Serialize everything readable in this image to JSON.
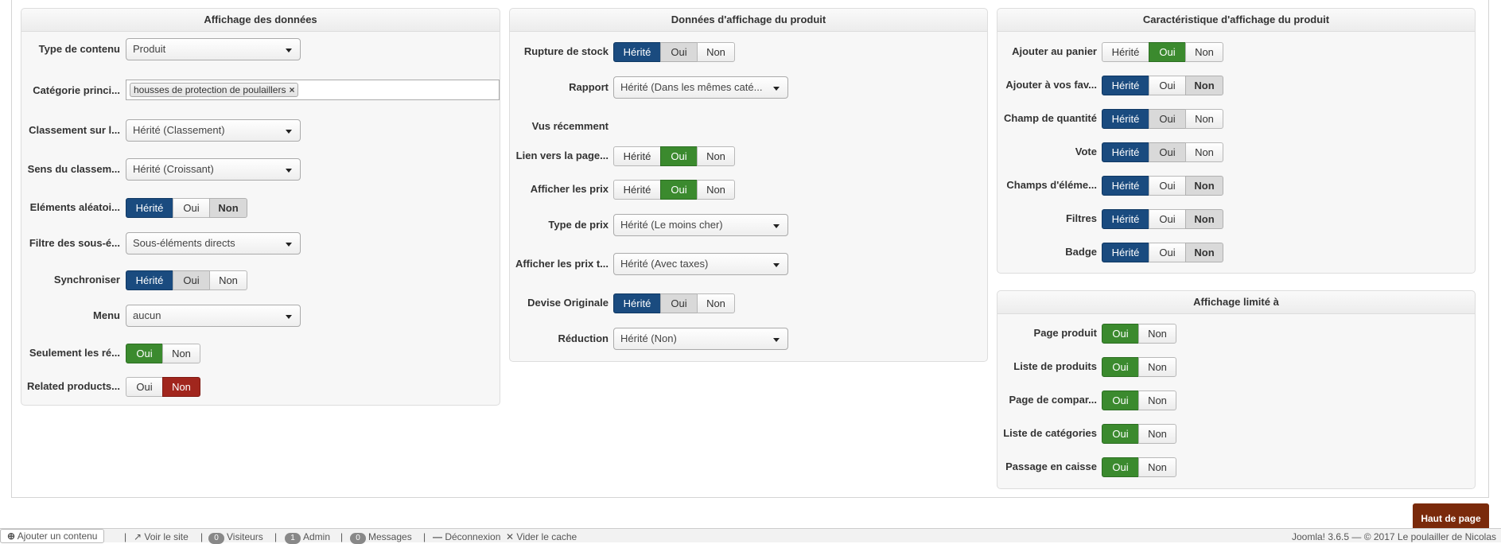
{
  "panel1": {
    "title": "Affichage des données",
    "type_contenu": {
      "label": "Type de contenu",
      "value": "Produit"
    },
    "categorie": {
      "label": "Catégorie princi...",
      "tag": "housses de protection de poulaillers"
    },
    "classement": {
      "label": "Classement sur l...",
      "value": "Hérité (Classement)"
    },
    "sens": {
      "label": "Sens du classem...",
      "value": "Hérité (Croissant)"
    },
    "aleatoire": {
      "label": "Eléments aléatoi...",
      "opt1": "Hérité",
      "opt2": "Oui",
      "opt3": "Non"
    },
    "filtre": {
      "label": "Filtre des sous-é...",
      "value": "Sous-éléments directs"
    },
    "synchroniser": {
      "label": "Synchroniser",
      "opt1": "Hérité",
      "opt2": "Oui",
      "opt3": "Non"
    },
    "menu": {
      "label": "Menu",
      "value": "aucun"
    },
    "seulement": {
      "label": "Seulement les ré...",
      "opt1": "Oui",
      "opt2": "Non"
    },
    "related": {
      "label": "Related products...",
      "opt1": "Oui",
      "opt2": "Non"
    }
  },
  "panel2": {
    "title": "Données d'affichage du produit",
    "rupture": {
      "label": "Rupture de stock",
      "opt1": "Hérité",
      "opt2": "Oui",
      "opt3": "Non"
    },
    "rapport": {
      "label": "Rapport",
      "value": "Hérité (Dans les mêmes caté..."
    },
    "vus": {
      "label": "Vus récemment"
    },
    "lien": {
      "label": "Lien vers la page...",
      "opt1": "Hérité",
      "opt2": "Oui",
      "opt3": "Non"
    },
    "afficher_prix": {
      "label": "Afficher les prix",
      "opt1": "Hérité",
      "opt2": "Oui",
      "opt3": "Non"
    },
    "type_prix": {
      "label": "Type de prix",
      "value": "Hérité (Le moins cher)"
    },
    "prix_taxes": {
      "label": "Afficher les prix t...",
      "value": "Hérité (Avec taxes)"
    },
    "devise": {
      "label": "Devise Originale",
      "opt1": "Hérité",
      "opt2": "Oui",
      "opt3": "Non"
    },
    "reduction": {
      "label": "Réduction",
      "value": "Hérité (Non)"
    }
  },
  "panel3": {
    "title": "Caractéristique d'affichage du produit",
    "panier": {
      "label": "Ajouter au panier",
      "opt1": "Hérité",
      "opt2": "Oui",
      "opt3": "Non"
    },
    "favoris": {
      "label": "Ajouter à vos fav...",
      "opt1": "Hérité",
      "opt2": "Oui",
      "opt3": "Non"
    },
    "quantite": {
      "label": "Champ de quantité",
      "opt1": "Hérité",
      "opt2": "Oui",
      "opt3": "Non"
    },
    "vote": {
      "label": "Vote",
      "opt1": "Hérité",
      "opt2": "Oui",
      "opt3": "Non"
    },
    "champs": {
      "label": "Champs d'éléme...",
      "opt1": "Hérité",
      "opt2": "Oui",
      "opt3": "Non"
    },
    "filtres": {
      "label": "Filtres",
      "opt1": "Hérité",
      "opt2": "Oui",
      "opt3": "Non"
    },
    "badge": {
      "label": "Badge",
      "opt1": "Hérité",
      "opt2": "Oui",
      "opt3": "Non"
    }
  },
  "panel4": {
    "title": "Affichage limité à",
    "page_produit": {
      "label": "Page produit",
      "opt1": "Oui",
      "opt2": "Non"
    },
    "liste_produits": {
      "label": "Liste de produits",
      "opt1": "Oui",
      "opt2": "Non"
    },
    "page_compar": {
      "label": "Page de compar...",
      "opt1": "Oui",
      "opt2": "Non"
    },
    "liste_categories": {
      "label": "Liste de catégories",
      "opt1": "Oui",
      "opt2": "Non"
    },
    "passage": {
      "label": "Passage en caisse",
      "opt1": "Oui",
      "opt2": "Non"
    }
  },
  "top_button": "Haut de page",
  "footer": {
    "add_content": "Ajouter un contenu",
    "voir_site": "Voir le site",
    "visiteurs_count": "0",
    "visiteurs": "Visiteurs",
    "admin_count": "1",
    "admin": "Admin",
    "messages_count": "0",
    "messages": "Messages",
    "deconnexion": "Déconnexion",
    "vider_cache": "Vider le cache",
    "copyright": "Joomla! 3.6.5  —  © 2017 Le poulailler de Nicolas"
  }
}
